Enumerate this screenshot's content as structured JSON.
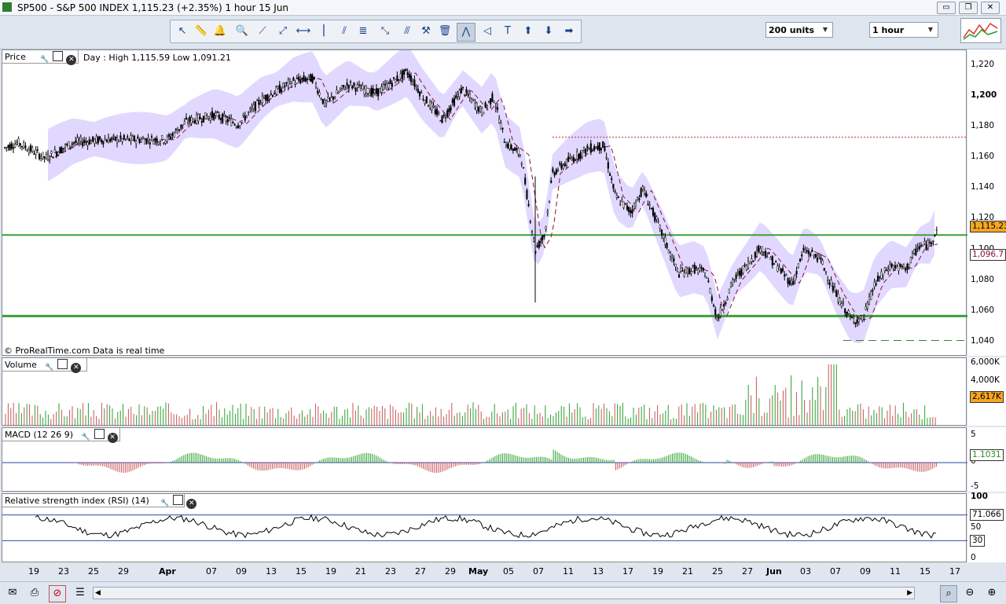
{
  "window": {
    "title": "SP500 - S&P 500 INDEX    1,115.23 (+2.35%)    1 hour  15 Jun",
    "buttons": [
      "▭",
      "❐",
      "✕"
    ]
  },
  "toolbar": {
    "tools": [
      {
        "icon": "pointer-icon",
        "glyph": "↖"
      },
      {
        "icon": "ruler-icon",
        "glyph": "📏"
      },
      {
        "icon": "alarm-icon",
        "glyph": "🔔"
      },
      {
        "icon": "zoom-icon",
        "glyph": "🔍"
      },
      {
        "icon": "line-icon",
        "glyph": "⟋"
      },
      {
        "icon": "ray-icon",
        "glyph": "⤢"
      },
      {
        "icon": "horizontal-line-icon",
        "glyph": "⟷"
      },
      {
        "icon": "vertical-line-icon",
        "glyph": "⎮"
      },
      {
        "icon": "channel-icon",
        "glyph": "⫽"
      },
      {
        "icon": "fibonacci-icon",
        "glyph": "≣"
      },
      {
        "icon": "fan-icon",
        "glyph": "⤡"
      },
      {
        "icon": "parallel-icon",
        "glyph": "⫻"
      },
      {
        "icon": "tools-icon",
        "glyph": "⚒"
      },
      {
        "icon": "trash-icon",
        "glyph": "🗑"
      },
      {
        "icon": "trend-icon",
        "glyph": "⋀"
      },
      {
        "icon": "triangle-icon",
        "glyph": "◁"
      },
      {
        "icon": "text-icon",
        "glyph": "T"
      },
      {
        "icon": "buy-arrow-icon",
        "glyph": "⬆"
      },
      {
        "icon": "sell-arrow-icon",
        "glyph": "⬇"
      },
      {
        "icon": "right-arrow-icon",
        "glyph": "➡"
      }
    ],
    "units_select": "200 units",
    "timeframe_select": "1 hour"
  },
  "price_panel": {
    "tab_label": "Price",
    "info": "Day : High 1,115.59 Low 1,091.21",
    "watermark": "© ProRealTime.com  Data is real time",
    "y_ticks": [
      "1,220",
      "1,200",
      "1,180",
      "1,160",
      "1,140",
      "1,120",
      "1,100",
      "1,080",
      "1,060",
      "1,040"
    ],
    "y_bold": "1,200",
    "last_price": "1,115.23",
    "ma_value": "1,096.7"
  },
  "volume_panel": {
    "tab_label": "Volume",
    "y_ticks": [
      "6,000K",
      "4,000K",
      "2,000K"
    ],
    "last_value": "2,617K"
  },
  "macd_panel": {
    "tab_label": "MACD (12 26 9)",
    "y_ticks": [
      "5",
      "0",
      "-5"
    ],
    "last_value": "1.1031"
  },
  "rsi_panel": {
    "tab_label": "Relative strength index (RSI) (14)",
    "y_ticks": [
      "100",
      "50",
      "0"
    ],
    "last_value": "71.066",
    "oversold_label": "30"
  },
  "x_axis": {
    "labels": [
      "19",
      "23",
      "25",
      "29",
      "Apr",
      "07",
      "09",
      "13",
      "15",
      "19",
      "21",
      "23",
      "27",
      "29",
      "May",
      "05",
      "07",
      "11",
      "13",
      "17",
      "19",
      "21",
      "25",
      "27",
      "Jun",
      "03",
      "07",
      "09",
      "11",
      "15",
      "17"
    ],
    "bold_labels": [
      "Apr",
      "May",
      "Jun"
    ]
  },
  "statusbar": {
    "icons": [
      "mail-icon",
      "print-icon",
      "no-sound-icon",
      "list-icon",
      "zoom-cursor-icon",
      "zoom-out-icon",
      "zoom-in-icon"
    ]
  },
  "colors": {
    "bullish": "#2da02d",
    "bearish": "#c8555a",
    "band": "#e0d8ff",
    "ma": "#8b0f3a",
    "support_line": "#3aa13a",
    "resistance_dotted": "#cc2222",
    "last_price_badge": "#f5a623"
  },
  "chart_data": {
    "type": "candlestick",
    "x_dates": [
      "Mar 19",
      "Mar 23",
      "Mar 25",
      "Mar 29",
      "Apr",
      "Apr 07",
      "Apr 09",
      "Apr 13",
      "Apr 15",
      "Apr 19",
      "Apr 21",
      "Apr 23",
      "Apr 27",
      "Apr 29",
      "May",
      "May 05",
      "May 07",
      "May 11",
      "May 13",
      "May 17",
      "May 19",
      "May 21",
      "May 25",
      "May 27",
      "Jun",
      "Jun 03",
      "Jun 07",
      "Jun 09",
      "Jun 11",
      "Jun 15"
    ],
    "close_approx": [
      1166,
      1170,
      1168,
      1175,
      1180,
      1186,
      1190,
      1198,
      1212,
      1205,
      1210,
      1203,
      1215,
      1204,
      1198,
      1168,
      1096,
      1152,
      1170,
      1115,
      1110,
      1082,
      1065,
      1085,
      1098,
      1103,
      1062,
      1048,
      1080,
      1115
    ],
    "ylim": [
      1040,
      1225
    ],
    "horizontal_lines": [
      1109.9,
      1057.2,
      1173.5,
      1041.3
    ],
    "last_close": 1115.23,
    "moving_average_last": 1096.7
  }
}
